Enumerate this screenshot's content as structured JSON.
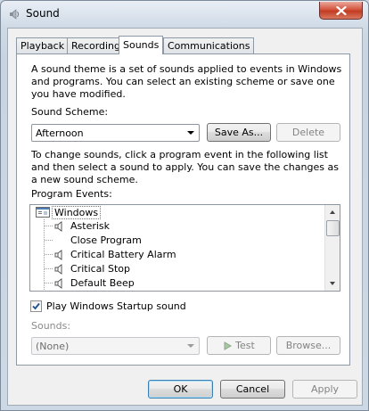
{
  "window": {
    "title": "Sound",
    "close_icon": "close-icon"
  },
  "tabs": [
    {
      "label": "Playback"
    },
    {
      "label": "Recording"
    },
    {
      "label": "Sounds"
    },
    {
      "label": "Communications"
    }
  ],
  "sounds_tab": {
    "description": "A sound theme is a set of sounds applied to events in Windows and programs.  You can select an existing scheme or save one you have modified.",
    "scheme_label": "Sound Scheme:",
    "scheme_value": "Afternoon",
    "save_as_label": "Save As...",
    "delete_label": "Delete",
    "instructions": "To change sounds, click a program event in the following list and then select a sound to apply.  You can save the changes as a new sound scheme.",
    "events_label": "Program Events:",
    "events": [
      {
        "label": "Windows",
        "icon": "windows-icon",
        "type": "group"
      },
      {
        "label": "Asterisk",
        "icon": "speaker-icon",
        "type": "item"
      },
      {
        "label": "Close Program",
        "icon": "",
        "type": "item"
      },
      {
        "label": "Critical Battery Alarm",
        "icon": "speaker-icon",
        "type": "item"
      },
      {
        "label": "Critical Stop",
        "icon": "speaker-icon",
        "type": "item"
      },
      {
        "label": "Default Beep",
        "icon": "speaker-icon",
        "type": "item"
      }
    ],
    "startup_checkbox_label": "Play Windows Startup sound",
    "startup_checked": true,
    "sounds_label": "Sounds:",
    "sounds_value": "(None)",
    "test_label": "Test",
    "browse_label": "Browse..."
  },
  "footer": {
    "ok_label": "OK",
    "cancel_label": "Cancel",
    "apply_label": "Apply"
  }
}
